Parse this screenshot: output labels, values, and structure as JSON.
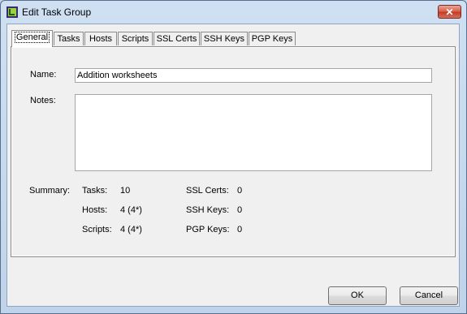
{
  "window": {
    "title": "Edit Task Group",
    "close_label": "✕"
  },
  "tabs": [
    {
      "label": "General",
      "active": true
    },
    {
      "label": "Tasks",
      "active": false
    },
    {
      "label": "Hosts",
      "active": false
    },
    {
      "label": "Scripts",
      "active": false
    },
    {
      "label": "SSL Certs",
      "active": false
    },
    {
      "label": "SSH Keys",
      "active": false
    },
    {
      "label": "PGP Keys",
      "active": false
    }
  ],
  "form": {
    "name_label": "Name:",
    "name_value": "Addition worksheets",
    "notes_label": "Notes:",
    "notes_value": ""
  },
  "summary": {
    "label": "Summary:",
    "left": [
      {
        "label": "Tasks:",
        "value": "10"
      },
      {
        "label": "Hosts:",
        "value": "4 (4*)"
      },
      {
        "label": "Scripts:",
        "value": "4 (4*)"
      }
    ],
    "right": [
      {
        "label": "SSL Certs:",
        "value": "0"
      },
      {
        "label": "SSH Keys:",
        "value": "0"
      },
      {
        "label": "PGP Keys:",
        "value": "0"
      }
    ]
  },
  "buttons": {
    "ok": "OK",
    "cancel": "Cancel"
  }
}
